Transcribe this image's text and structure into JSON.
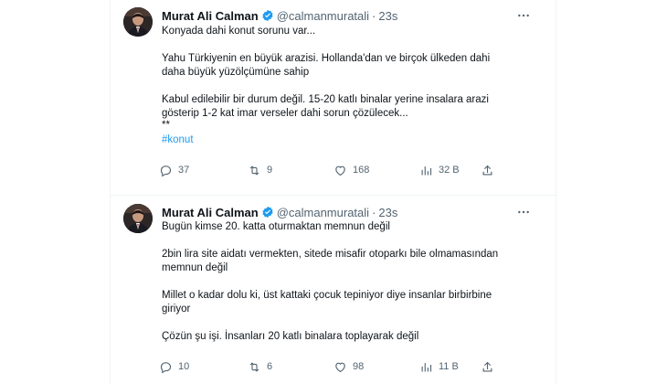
{
  "tweets": [
    {
      "author": {
        "name": "Murat Ali Calman",
        "handle": "@calmanmuratali",
        "separator": "·",
        "time": "23s"
      },
      "lines": [
        "Konyada dahi konut sorunu var...",
        "",
        "Yahu Türkiyenin en büyük arazisi. Hollanda'dan ve birçok ülkeden dahi",
        "daha büyük yüzölçümüne sahip",
        "",
        "Kabul edilebilir bir durum değil. 15-20 katlı binalar yerine insalara arazi",
        "gösterip 1-2 kat imar verseler dahi sorun çözülecek...",
        "**"
      ],
      "hashtag": "#konut",
      "stats": {
        "replies": "37",
        "retweets": "9",
        "likes": "168",
        "views": "32 B"
      }
    },
    {
      "author": {
        "name": "Murat Ali Calman",
        "handle": "@calmanmuratali",
        "separator": "·",
        "time": "23s"
      },
      "lines": [
        "Bugün kimse 20. katta oturmaktan memnun değil",
        "",
        "2bin lira site aidatı vermekten, sitede misafir otoparkı bile olmamasından",
        "memnun değil",
        "",
        "Millet o kadar dolu ki, üst kattaki çocuk tepiniyor diye insanlar birbirbine",
        "giriyor",
        "",
        "Çözün şu işi. İnsanları 20 katlı binalara toplayarak değil"
      ],
      "stats": {
        "replies": "10",
        "retweets": "6",
        "likes": "98",
        "views": "11 B"
      }
    }
  ],
  "colors": {
    "text": "#0f1419",
    "muted": "#536471",
    "accent": "#1d9bf0",
    "divider": "#eff3f4"
  },
  "icons": [
    "avatar",
    "verified-badge-icon",
    "more-icon",
    "reply-icon",
    "retweet-icon",
    "like-icon",
    "views-icon",
    "share-icon"
  ]
}
